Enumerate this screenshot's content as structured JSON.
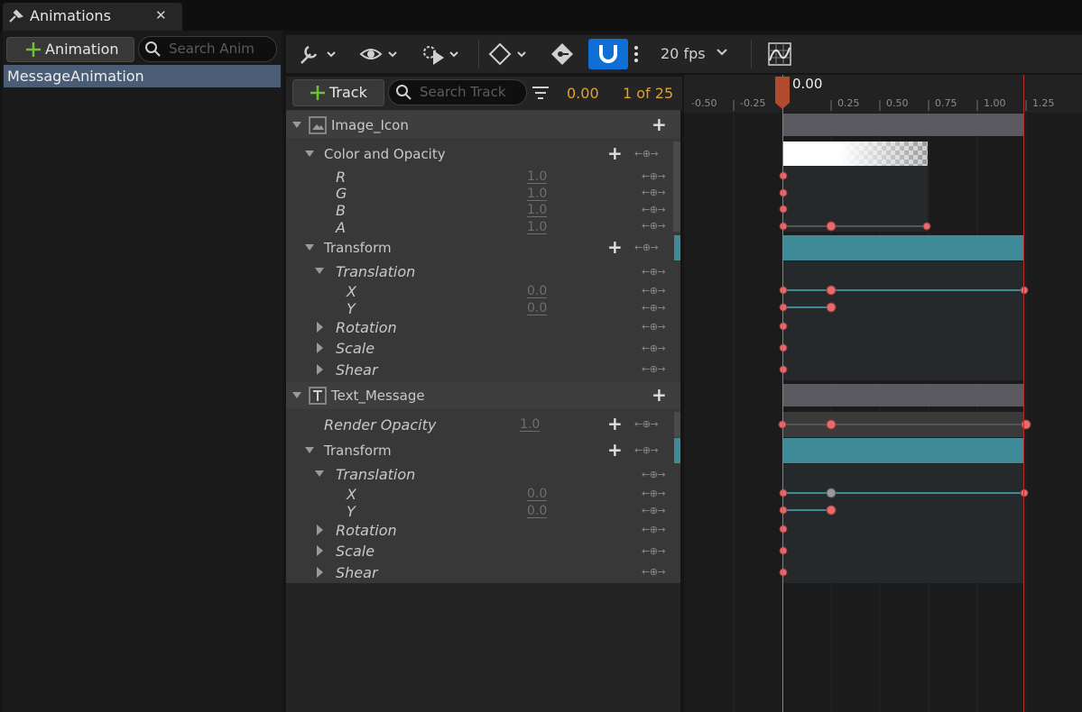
{
  "tab": {
    "title": "Animations",
    "close": "✕"
  },
  "left": {
    "add_button": "Animation",
    "search_placeholder": "Search Anim",
    "animations": [
      "MessageAnimation"
    ]
  },
  "toolbar": {
    "fps": "20 fps"
  },
  "tracks_header": {
    "add_track": "Track",
    "search_placeholder": "Search Track",
    "time": "0.00",
    "frame": "1 of 25"
  },
  "outliner": {
    "image_icon": "Image_Icon",
    "color_opacity": "Color and Opacity",
    "r": "R",
    "g": "G",
    "b": "B",
    "a": "A",
    "r_val": "1.0",
    "g_val": "1.0",
    "b_val": "1.0",
    "a_val": "1.0",
    "transform1": "Transform",
    "translation1": "Translation",
    "x1": "X",
    "y1": "Y",
    "x1_val": "0.0",
    "y1_val": "0.0",
    "rotation1": "Rotation",
    "scale1": "Scale",
    "shear1": "Shear",
    "text_message": "Text_Message",
    "render_opacity": "Render Opacity",
    "render_opacity_val": "1.0",
    "transform2": "Transform",
    "translation2": "Translation",
    "x2": "X",
    "y2": "Y",
    "x2_val": "0.0",
    "y2_val": "0.0",
    "rotation2": "Rotation",
    "scale2": "Scale",
    "shear2": "Shear"
  },
  "timeline": {
    "playhead": "0.00",
    "ticks": [
      "-0.50",
      "-0.25",
      "0.25",
      "0.50",
      "0.75",
      "1.00",
      "1.25"
    ]
  },
  "colors": {
    "accent": "#0f6fd6",
    "time": "#e3a02d",
    "teal": "#3f8a98",
    "key": "#e86a6a",
    "selection": "#4a5d75"
  }
}
